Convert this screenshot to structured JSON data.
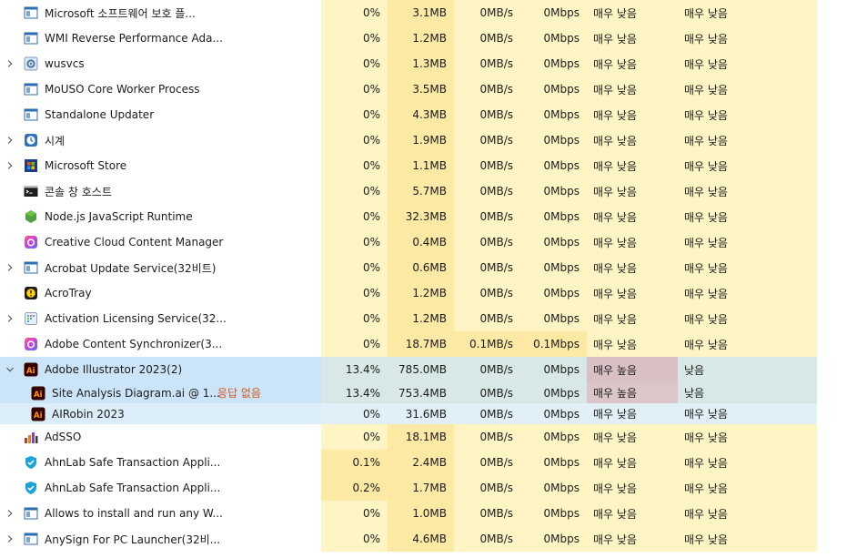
{
  "colors": {
    "heat_low": "#fff4c4",
    "heat_mid": "#fce9a3",
    "heat_warm": "#f9e29a",
    "power_high": "#d9c0c4",
    "power_high_child": "#dcc6c9",
    "selected": "#cce4f7",
    "selected_metric": "#d7e8e6",
    "not_responding": "#d2581e"
  },
  "processes": [
    {
      "name": "Microsoft 소프트웨어 보호 플...",
      "icon": "window-icon",
      "expandable": false,
      "cpu": "0%",
      "memory": "3.1MB",
      "disk": "0MB/s",
      "network": "0Mbps",
      "power": "매우 낮음",
      "power_trend": "매우 낮음"
    },
    {
      "name": "WMI Reverse Performance Ada...",
      "icon": "window-icon",
      "expandable": false,
      "cpu": "0%",
      "memory": "1.2MB",
      "disk": "0MB/s",
      "network": "0Mbps",
      "power": "매우 낮음",
      "power_trend": "매우 낮음"
    },
    {
      "name": "wusvcs",
      "icon": "gear-icon",
      "expandable": true,
      "cpu": "0%",
      "memory": "1.3MB",
      "disk": "0MB/s",
      "network": "0Mbps",
      "power": "매우 낮음",
      "power_trend": "매우 낮음"
    },
    {
      "name": "MoUSO Core Worker Process",
      "icon": "window-icon",
      "expandable": false,
      "cpu": "0%",
      "memory": "3.5MB",
      "disk": "0MB/s",
      "network": "0Mbps",
      "power": "매우 낮음",
      "power_trend": "매우 낮음"
    },
    {
      "name": "Standalone Updater",
      "icon": "window-icon",
      "expandable": false,
      "cpu": "0%",
      "memory": "4.3MB",
      "disk": "0MB/s",
      "network": "0Mbps",
      "power": "매우 낮음",
      "power_trend": "매우 낮음"
    },
    {
      "name": "시계",
      "icon": "clock-icon",
      "expandable": true,
      "cpu": "0%",
      "memory": "1.9MB",
      "disk": "0MB/s",
      "network": "0Mbps",
      "power": "매우 낮음",
      "power_trend": "매우 낮음"
    },
    {
      "name": "Microsoft Store",
      "icon": "store-icon",
      "expandable": true,
      "cpu": "0%",
      "memory": "1.1MB",
      "disk": "0MB/s",
      "network": "0Mbps",
      "power": "매우 낮음",
      "power_trend": "매우 낮음"
    },
    {
      "name": "콘솔 창 호스트",
      "icon": "console-icon",
      "expandable": false,
      "cpu": "0%",
      "memory": "5.7MB",
      "disk": "0MB/s",
      "network": "0Mbps",
      "power": "매우 낮음",
      "power_trend": "매우 낮음"
    },
    {
      "name": "Node.js JavaScript Runtime",
      "icon": "nodejs-icon",
      "expandable": false,
      "cpu": "0%",
      "memory": "32.3MB",
      "disk": "0MB/s",
      "network": "0Mbps",
      "power": "매우 낮음",
      "power_trend": "매우 낮음"
    },
    {
      "name": "Creative Cloud Content Manager",
      "icon": "creative-cloud-icon",
      "expandable": false,
      "cpu": "0%",
      "memory": "0.4MB",
      "disk": "0MB/s",
      "network": "0Mbps",
      "power": "매우 낮음",
      "power_trend": "매우 낮음"
    },
    {
      "name": "Acrobat Update Service(32비트)",
      "icon": "window-icon",
      "expandable": true,
      "cpu": "0%",
      "memory": "0.6MB",
      "disk": "0MB/s",
      "network": "0Mbps",
      "power": "매우 낮음",
      "power_trend": "매우 낮음"
    },
    {
      "name": "AcroTray",
      "icon": "acrotray-icon",
      "expandable": false,
      "cpu": "0%",
      "memory": "1.2MB",
      "disk": "0MB/s",
      "network": "0Mbps",
      "power": "매우 낮음",
      "power_trend": "매우 낮음"
    },
    {
      "name": "Activation Licensing Service(32...",
      "icon": "license-icon",
      "expandable": true,
      "cpu": "0%",
      "memory": "1.2MB",
      "disk": "0MB/s",
      "network": "0Mbps",
      "power": "매우 낮음",
      "power_trend": "매우 낮음"
    },
    {
      "name": "Adobe Content Synchronizer(3...",
      "icon": "creative-cloud-icon",
      "expandable": false,
      "cpu": "0%",
      "memory": "18.7MB",
      "disk": "0.1MB/s",
      "network": "0.1Mbps",
      "power": "매우 낮음",
      "power_trend": "매우 낮음"
    },
    {
      "name": "Adobe Illustrator 2023(2)",
      "icon": "illustrator-icon",
      "expandable": true,
      "expanded": true,
      "selected": true,
      "cpu": "13.4%",
      "memory": "785.0MB",
      "disk": "0MB/s",
      "network": "0Mbps",
      "power": "매우 높음",
      "power_trend": "낮음",
      "children": [
        {
          "name": "Site Analysis Diagram.ai @ 1...",
          "status": "응답 없음",
          "icon": "illustrator-icon",
          "cpu": "13.4%",
          "memory": "753.4MB",
          "disk": "0MB/s",
          "network": "0Mbps",
          "power": "매우 높음",
          "power_trend": "낮음"
        },
        {
          "name": "AIRobin 2023",
          "icon": "illustrator-icon",
          "cpu": "0%",
          "memory": "31.6MB",
          "disk": "0MB/s",
          "network": "0Mbps",
          "power": "매우 낮음",
          "power_trend": "매우 낮음"
        }
      ]
    },
    {
      "name": "AdSSO",
      "icon": "adsso-icon",
      "expandable": false,
      "cpu": "0%",
      "memory": "18.1MB",
      "disk": "0MB/s",
      "network": "0Mbps",
      "power": "매우 낮음",
      "power_trend": "매우 낮음"
    },
    {
      "name": "AhnLab Safe Transaction Appli...",
      "icon": "ahnlab-shield-icon",
      "expandable": false,
      "cpu": "0.1%",
      "memory": "2.4MB",
      "disk": "0MB/s",
      "network": "0Mbps",
      "power": "매우 낮음",
      "power_trend": "매우 낮음"
    },
    {
      "name": "AhnLab Safe Transaction Appli...",
      "icon": "ahnlab-shield-icon",
      "expandable": false,
      "cpu": "0.2%",
      "memory": "1.7MB",
      "disk": "0MB/s",
      "network": "0Mbps",
      "power": "매우 낮음",
      "power_trend": "매우 낮음"
    },
    {
      "name": "Allows to install and run any W...",
      "icon": "window-icon",
      "expandable": true,
      "cpu": "0%",
      "memory": "1.0MB",
      "disk": "0MB/s",
      "network": "0Mbps",
      "power": "매우 낮음",
      "power_trend": "매우 낮음"
    },
    {
      "name": "AnySign For PC Launcher(32비...",
      "icon": "window-icon",
      "expandable": true,
      "cpu": "0%",
      "memory": "4.6MB",
      "disk": "0MB/s",
      "network": "0Mbps",
      "power": "매우 낮음",
      "power_trend": "매우 낮음"
    }
  ]
}
